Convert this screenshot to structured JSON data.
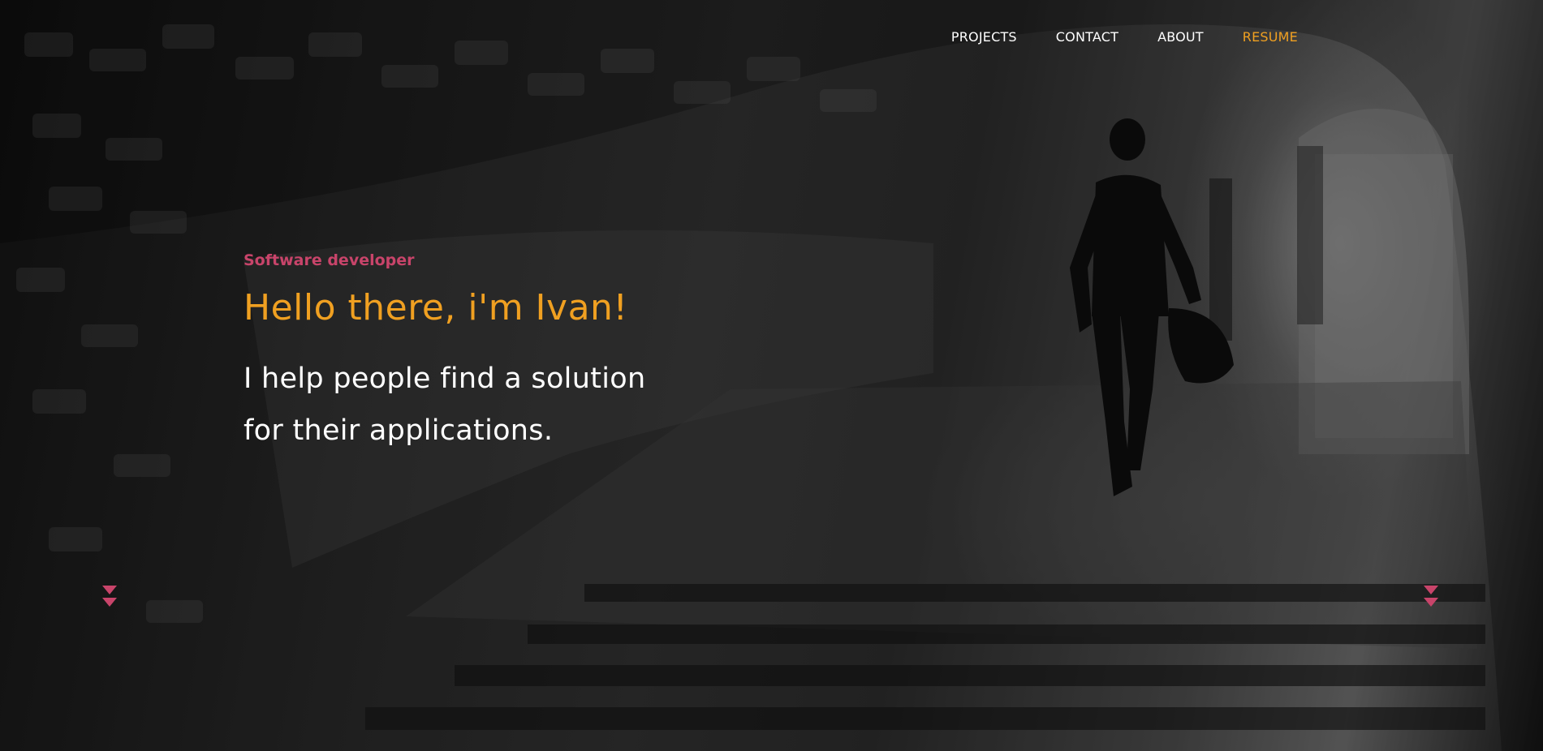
{
  "nav": {
    "items": [
      {
        "label": "PROJECTS"
      },
      {
        "label": "CONTACT"
      },
      {
        "label": "ABOUT"
      },
      {
        "label": "RESUME"
      }
    ]
  },
  "hero": {
    "subtitle": "Software developer",
    "headline": "Hello there, i'm Ivan!",
    "tagline_line1": "I help people find a solution",
    "tagline_line2": "for their applications."
  },
  "colors": {
    "accent_orange": "#f0a021",
    "accent_pink": "#c8446a",
    "text_white": "#ffffff"
  },
  "icons": {
    "scroll_left": "double-chevron-down-icon",
    "scroll_right": "double-chevron-down-icon"
  }
}
